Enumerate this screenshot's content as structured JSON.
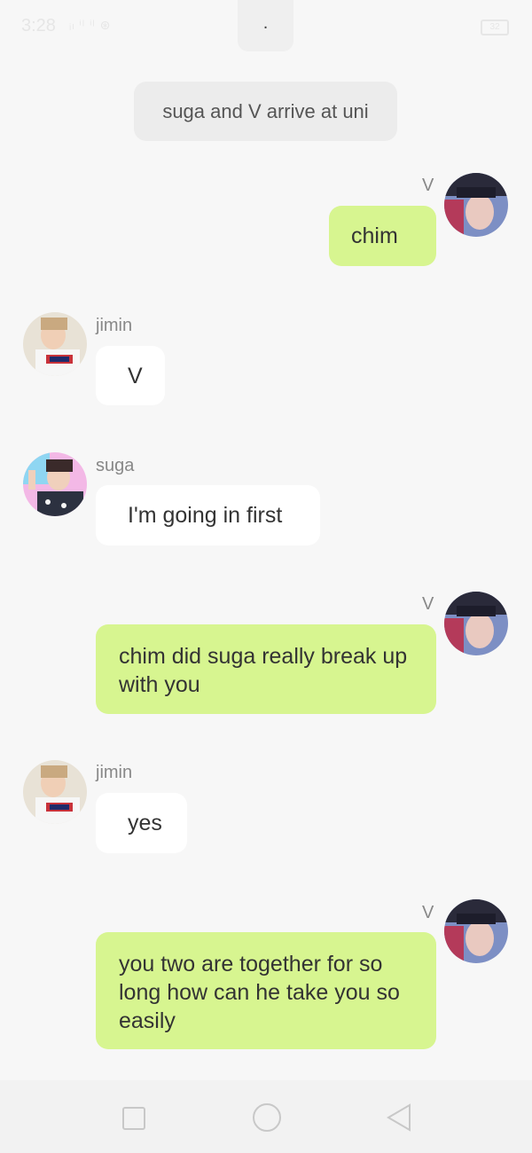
{
  "status_bar": {
    "time": "3:28",
    "icons": "ᵢₗ ⁱˡ ⁱˡ ⊛",
    "battery": "32"
  },
  "notch_text": ".",
  "narration": "suga and V arrive at uni",
  "messages": [
    {
      "sender": "V",
      "text": "chim",
      "side": "right",
      "avatar": "v-avatar"
    },
    {
      "sender": "jimin",
      "text": "V",
      "side": "left",
      "avatar": "jimin-avatar"
    },
    {
      "sender": "suga",
      "text": "I'm going in first",
      "side": "left",
      "avatar": "suga-avatar"
    },
    {
      "sender": "V",
      "text": "chim did suga really break up with you",
      "side": "right",
      "avatar": "v-avatar"
    },
    {
      "sender": "jimin",
      "text": "yes",
      "side": "left",
      "avatar": "jimin-avatar"
    },
    {
      "sender": "V",
      "text": "you two are together for so long how can he take you so easily",
      "side": "right",
      "avatar": "v-avatar"
    }
  ],
  "nav": {
    "recent_icon": "square-icon",
    "home_icon": "circle-icon",
    "back_icon": "back-triangle-icon"
  },
  "colors": {
    "background": "#f7f7f7",
    "right_bubble": "#d7f590",
    "left_bubble": "#ffffff",
    "narration_bg": "#ececec"
  }
}
